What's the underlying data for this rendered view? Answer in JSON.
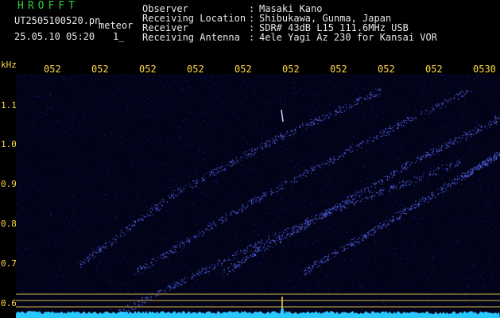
{
  "header": {
    "logo": "HROFFT",
    "filename": "UT2505100520.pn",
    "tag": "meteor",
    "datetime": "25.05.10 05:20",
    "extra": "1_",
    "fields": [
      {
        "label": "Observer",
        "sep": ":",
        "value": "Masaki Kano"
      },
      {
        "label": "Receiving Location",
        "sep": ":",
        "value": "Shibukawa, Gunma, Japan"
      },
      {
        "label": "Receiver",
        "sep": ":",
        "value": "SDR# 43dB L15 111.6MHz USB"
      },
      {
        "label": "Receiving Antenna",
        "sep": ":",
        "value": "4ele Yagi Az 230 for Kansai VOR"
      }
    ]
  },
  "spectrogram": {
    "y_unit": "kHz",
    "y_ticks": [
      "1.1",
      "1.0",
      "0.9",
      "0.8",
      "0.7",
      "0.6"
    ],
    "x_ticks": [
      "052",
      "052",
      "052",
      "052",
      "052",
      "052",
      "052",
      "052",
      "052",
      "0530"
    ],
    "colors": {
      "background": "#02021a",
      "noise": "#2030c8",
      "accent": "#ffd84a",
      "baseline": "#2ac8ff"
    }
  }
}
